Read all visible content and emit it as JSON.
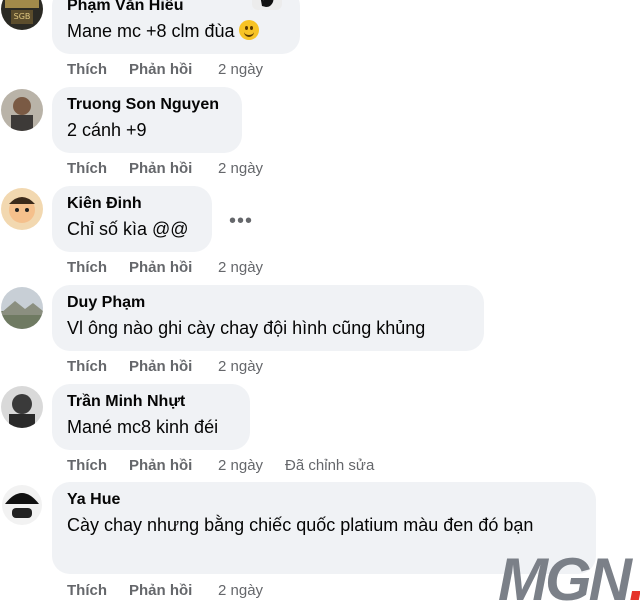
{
  "comments": [
    {
      "author": "Phạm Văn Hiếu",
      "text": "Mane mc +8 clm đùa",
      "like": "Thích",
      "reply": "Phản hồi",
      "time": "2 ngày",
      "avatar": "logo-avatar"
    },
    {
      "author": "Truong Son Nguyen",
      "text": "2 cánh +9",
      "like": "Thích",
      "reply": "Phản hồi",
      "time": "2 ngày",
      "avatar": "man-avatar"
    },
    {
      "author": "Kiên Đinh",
      "text": "Chỉ số kìa @@",
      "like": "Thích",
      "reply": "Phản hồi",
      "time": "2 ngày",
      "avatar": "cartoon-avatar"
    },
    {
      "author": "Duy Phạm",
      "text": "Vl ông nào ghi cày chay đội hình cũng khủng",
      "like": "Thích",
      "reply": "Phản hồi",
      "time": "2 ngày",
      "avatar": "landscape-avatar"
    },
    {
      "author": "Trần Minh Nhựt",
      "text": "Mané mc8 kinh đéi",
      "like": "Thích",
      "reply": "Phản hồi",
      "time": "2 ngày",
      "edited": "Đã chỉnh sửa",
      "avatar": "dark-avatar"
    },
    {
      "author": "Ya Hue",
      "text": "Cày chay nhưng bằng chiếc quốc platium màu đen đó bạn",
      "like": "Thích",
      "reply": "Phản hồi",
      "time": "2 ngày",
      "avatar": "black-white-avatar"
    }
  ],
  "more_options": "•••",
  "watermark": {
    "brand": "MGN",
    "dot": "."
  },
  "colors": {
    "bubble": "#f0f2f5",
    "meta_text": "#65676b",
    "text": "#050505"
  }
}
